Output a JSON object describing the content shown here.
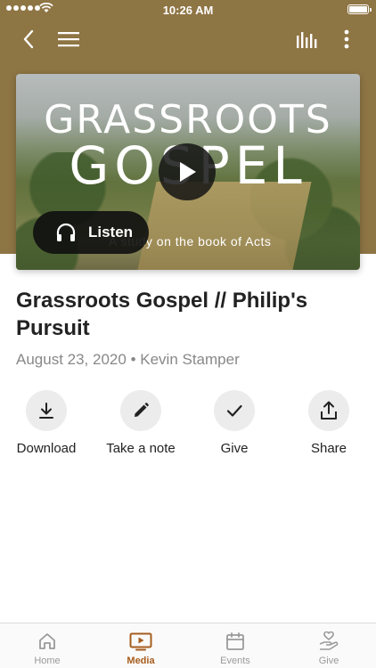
{
  "status_bar": {
    "time": "10:26 AM"
  },
  "nav": {
    "back_icon": "back-chevron-icon",
    "menu_icon": "hamburger-menu-icon",
    "chart_icon": "audio-bars-icon",
    "more_icon": "more-vertical-icon"
  },
  "media": {
    "art_line1": "GRASSROOTS",
    "art_line2": "GOSPEL",
    "art_subtitle": "A study on the book of Acts",
    "listen_label": "Listen"
  },
  "sermon": {
    "title": "Grassroots Gospel // Philip's Pursuit",
    "date": "August 23, 2020",
    "separator": "•",
    "speaker": "Kevin Stamper"
  },
  "actions": [
    {
      "label": "Download",
      "icon": "download-icon"
    },
    {
      "label": "Take a note",
      "icon": "pencil-icon"
    },
    {
      "label": "Give",
      "icon": "checkmark-icon"
    },
    {
      "label": "Share",
      "icon": "share-icon"
    }
  ],
  "tabs": [
    {
      "label": "Home",
      "icon": "home-icon"
    },
    {
      "label": "Media",
      "icon": "media-tv-icon",
      "active": true
    },
    {
      "label": "Events",
      "icon": "calendar-icon"
    },
    {
      "label": "Give",
      "icon": "give-hand-heart-icon"
    }
  ],
  "colors": {
    "header": "#8e7544",
    "accent": "#a65c1d",
    "inactive": "#9a9a9a"
  }
}
